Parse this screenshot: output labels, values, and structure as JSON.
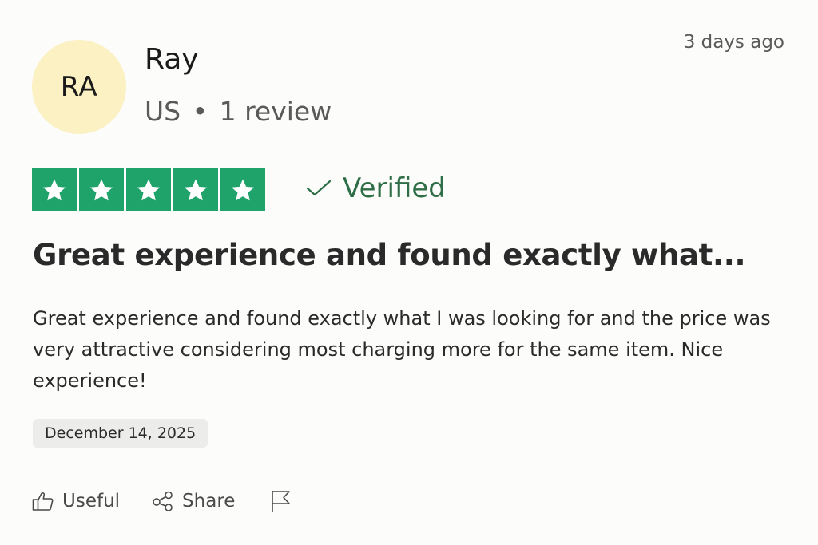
{
  "reviewer": {
    "initials": "RA",
    "name": "Ray",
    "country": "US",
    "separator": "•",
    "review_count": "1 review"
  },
  "review": {
    "relative_date": "3 days ago",
    "rating": 5,
    "rating_max": 5,
    "verified_label": "Verified",
    "title": "Great experience and found exactly what...",
    "body": "Great experience and found exactly what I was looking for and the price was very attractive considering most charging more for the same item. Nice experience!",
    "date": "December 14, 2025"
  },
  "actions": {
    "useful_label": "Useful",
    "share_label": "Share"
  },
  "colors": {
    "star_green": "#1fa36a",
    "verified_green": "#2e6e47",
    "avatar_bg": "#fbf1c2",
    "chip_bg": "#ececea"
  },
  "icons": [
    "thumbs-up-icon",
    "share-icon",
    "flag-icon",
    "checkmark-icon",
    "star-icon"
  ]
}
